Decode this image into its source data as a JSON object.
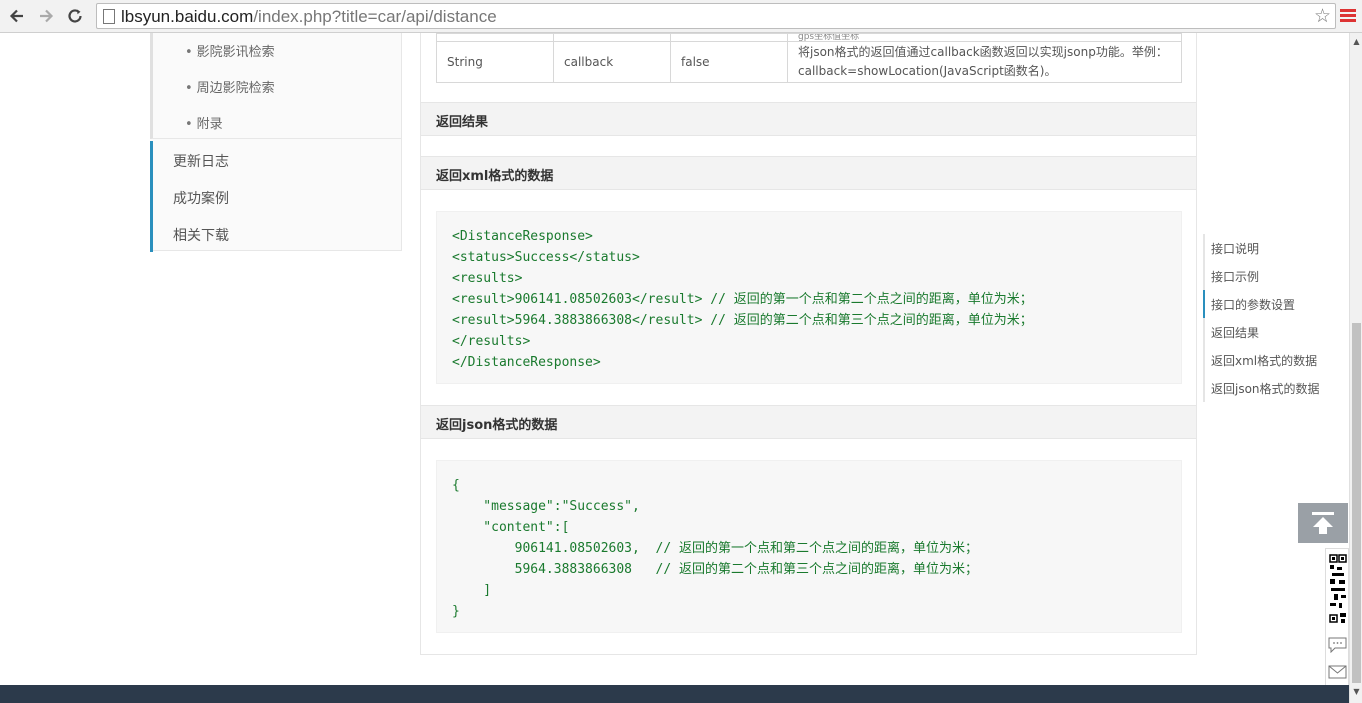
{
  "browser": {
    "url_host": "lbsyun.baidu.com",
    "url_path": "/index.php?title=car/api/distance"
  },
  "left_nav": {
    "sub_items": [
      "影院影讯检索",
      "周边影院检索",
      "附录"
    ],
    "main_items": [
      "更新日志",
      "成功案例",
      "相关下载"
    ]
  },
  "table": {
    "truncated_top": "gps坐标值坐标",
    "row": {
      "type": "String",
      "name": "callback",
      "required": "false",
      "desc_line1": "将json格式的返回值通过callback函数返回以实现jsonp功能。举例：",
      "desc_line2": "callback=showLocation(JavaScript函数名)。"
    }
  },
  "sections": {
    "result": "返回结果",
    "xml": "返回xml格式的数据",
    "json": "返回json格式的数据"
  },
  "xml_code": [
    "<DistanceResponse>",
    "<status>Success</status>",
    "<results>",
    "<result>906141.08502603</result> // 返回的第一个点和第二个点之间的距离，单位为米；",
    "<result>5964.3883866308</result> // 返回的第二个点和第三个点之间的距离，单位为米；",
    "</results>",
    "</DistanceResponse>"
  ],
  "json_code": [
    "{",
    "    \"message\":\"Success\",",
    "    \"content\":[",
    "        906141.08502603,  // 返回的第一个点和第二个点之间的距离，单位为米；",
    "        5964.3883866308   // 返回的第二个点和第三个点之间的距离，单位为米；",
    "    ]",
    "}"
  ],
  "toc": {
    "items": [
      "接口说明",
      "接口示例",
      "接口的参数设置",
      "返回结果",
      "返回xml格式的数据",
      "返回json格式的数据"
    ],
    "active": "接口的参数设置"
  },
  "colors": {
    "accent": "#2a8fbd",
    "code_text": "#1a7a2e",
    "footer": "#2c3a4b"
  },
  "icons": [
    "back-arrow-icon",
    "forward-arrow-icon",
    "reload-icon",
    "page-icon",
    "star-icon",
    "menu-icon",
    "back-to-top-icon",
    "qr-code-icon",
    "feedback-icon",
    "mail-icon",
    "edit-icon"
  ]
}
